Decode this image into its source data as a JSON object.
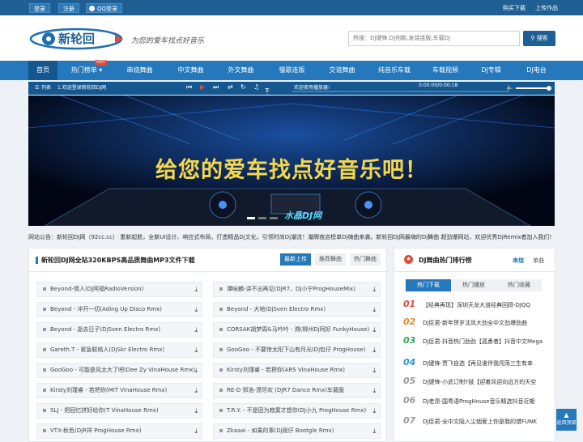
{
  "topbar": {
    "login": "登录",
    "register": "注册",
    "qq_login": "QQ登录",
    "buy_download": "购买下载",
    "upload": "上传作品"
  },
  "header": {
    "logo_text": "新轮回",
    "slogan": "为您的爱车找点好音乐",
    "search_placeholder": "热搜：DJ键锋,DJ何鹏,发烧连版,车载DJ",
    "search_button": "搜索"
  },
  "nav": {
    "items": [
      "首页",
      "热门榜单",
      "串烧舞曲",
      "中文舞曲",
      "外文舞曲",
      "慢歌连版",
      "交谊舞曲",
      "纯音乐车载",
      "车载视频",
      "DJ专辑",
      "DJ电台"
    ],
    "badge": "HOT"
  },
  "player": {
    "list_label": "列表",
    "current": "1.欢迎登录新轮回DJ网",
    "download": "下载",
    "welcome": "欢迎使用播放器!",
    "time": "0:00:00/0:00:18"
  },
  "banner": {
    "text": "给您的爱车找点好音乐吧！",
    "watermark": "水晶DJ网"
  },
  "notice": "网站公告：新轮回DJ网（92cc.cc） 重新起航，全新UI设计、响应式布局，打造精品Dj文化，引领时尚Dj潮流！潮牌夜店榜单Dj嗨曲来袭。新轮回DJ网最嗨的Dj舞曲 超劲爆网站，欢迎优秀DjRemix者加入我们!",
  "main": {
    "title": "新轮回DJ网全站320KBPS高品质舞曲MP3文件下载",
    "tabs": [
      "最新上传",
      "推荐舞曲",
      "热门舞曲"
    ],
    "left_songs": [
      "Beyond-情人(DJ阿福RadioVersion)",
      "Beyond - 冲开一切(Ading Up Disco Rmx)",
      "Beyond - 逝去日子(DjSven Electro Rmx)",
      "Gareth.T - 紧急联络人(DjSkr Electro Rmx)",
      "GooGoo - 可能是风太大了吧(Dee Zy VinaHouse Rmx)",
      "Kirsty刘瑾睿 - 若把你(MIT VinaHouse Rmx)",
      "SLJ - 把回忆拼好给你(T VinaHouse Rmx)",
      "VTX-秋色(DjR祥 ProgHouse Rmx)"
    ],
    "right_songs": [
      "谭咏麟-讲不出再见(DJR7、DJ小宁ProgHouseMix)",
      "Beyond - 大地(DjSven Electro Rmx)",
      "CORSAK胡梦周&马吟吟 - 溯(柳州Dj阿好 FunkyHouse)",
      "GooGoo - 不要惊太阳下山有月光(Dj包仔 ProgHouse)",
      "Kirsty刘瑾睿 - 若把你(ARS VinaHouse Rmx)",
      "RE-D 郑浩-漂尽欢 (DJR7 Dance Rmx)车载版",
      "T.R.Y. - 不是因为寂寞才想你(DJ小九 ProgHouse Rmx)",
      "Zkaaai - 如果的事(Dj刚仔 Bootgle Rmx)"
    ]
  },
  "ranking": {
    "title": "DJ舞曲热门排行榜",
    "switch_a": "串烧",
    "switch_b": "单曲",
    "tabs": [
      "热门下载",
      "热门播放",
      "热门收藏"
    ],
    "items": [
      {
        "num": "01",
        "text": "【经典再现】深圳天龙大道经典回顾-DJQQ"
      },
      {
        "num": "02",
        "text": "DJ臣君-新年贺岁沈凤大劲全中文劲爆劲曲"
      },
      {
        "num": "03",
        "text": "DJ臣君-抖音热门劲劲【孤勇者】抖音中文Mega"
      },
      {
        "num": "04",
        "text": "DJ键锋-贾飞自选【再见谁伴我闯荡三生有幸"
      },
      {
        "num": "05",
        "text": "DJ键锋-小武订制Y鼓【迎着风迎向远方的天空"
      },
      {
        "num": "06",
        "text": "DJ老昂-国粤语ProgHouse音乐精选抖音近期"
      },
      {
        "num": "07",
        "text": "DJ臣君-全中文隐入尘烟爱上你是我的错FUNK"
      }
    ]
  },
  "totop": "返回顶部",
  "colors": {
    "primary": "#2478bb",
    "dark": "#1f5f94",
    "rank_top": "#e04a3a",
    "rank_2": "#e8842a",
    "rank_3": "#2fa84a",
    "rank_4": "#2a9ad8"
  }
}
